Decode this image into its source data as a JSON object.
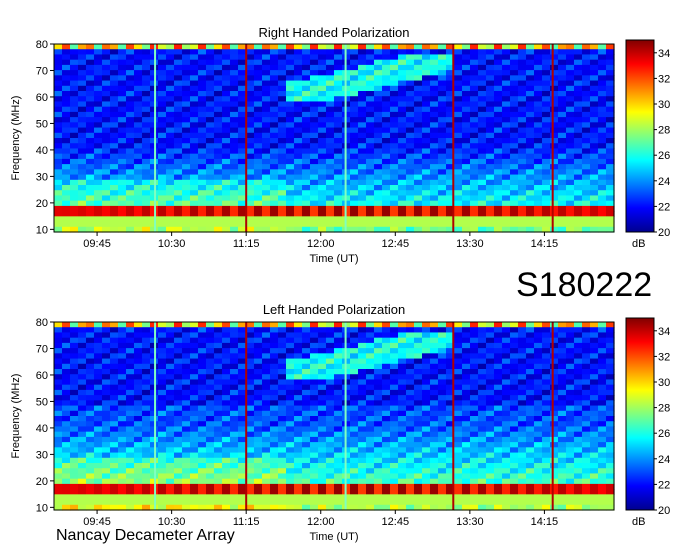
{
  "figure": {
    "event_id": "S180222",
    "station": "Nancay Decameter Array"
  },
  "chart_data": [
    {
      "type": "heatmap",
      "title": "Right Handed Polarization",
      "xlabel": "Time (UT)",
      "ylabel": "Frequency (MHz)",
      "x_ticks": [
        "09:45",
        "10:30",
        "11:15",
        "12:00",
        "12:45",
        "13:30",
        "14:15"
      ],
      "x_range": [
        "09:19",
        "14:57"
      ],
      "y_ticks": [
        10,
        20,
        30,
        40,
        50,
        60,
        70,
        80
      ],
      "ylim": [
        9,
        80
      ],
      "colorbar": {
        "label": "dB",
        "ticks": [
          20,
          22,
          24,
          26,
          28,
          30,
          32,
          34
        ],
        "range": [
          20,
          35
        ],
        "colormap": "jet"
      },
      "features": [
        "strong interference bands 14-20 MHz",
        "vertical spikes near 10:20, 11:15, 12:15, 13:20, 14:20",
        "drifting emission 60-75 MHz between 11:40 and 13:20"
      ]
    },
    {
      "type": "heatmap",
      "title": "Left Handed Polarization",
      "xlabel": "Time (UT)",
      "ylabel": "Frequency (MHz)",
      "x_ticks": [
        "09:45",
        "10:30",
        "11:15",
        "12:00",
        "12:45",
        "13:30",
        "14:15"
      ],
      "x_range": [
        "09:19",
        "14:57"
      ],
      "y_ticks": [
        10,
        20,
        30,
        40,
        50,
        60,
        70,
        80
      ],
      "ylim": [
        9,
        80
      ],
      "colorbar": {
        "label": "dB",
        "ticks": [
          20,
          22,
          24,
          26,
          28,
          30,
          32,
          34
        ],
        "range": [
          20,
          35
        ],
        "colormap": "jet"
      },
      "features": [
        "strong interference bands 14-20 MHz",
        "vertical spikes near 10:20, 11:15, 12:15, 13:20, 14:20",
        "drifting emission 60-75 MHz between 11:40 and 13:20"
      ]
    }
  ]
}
